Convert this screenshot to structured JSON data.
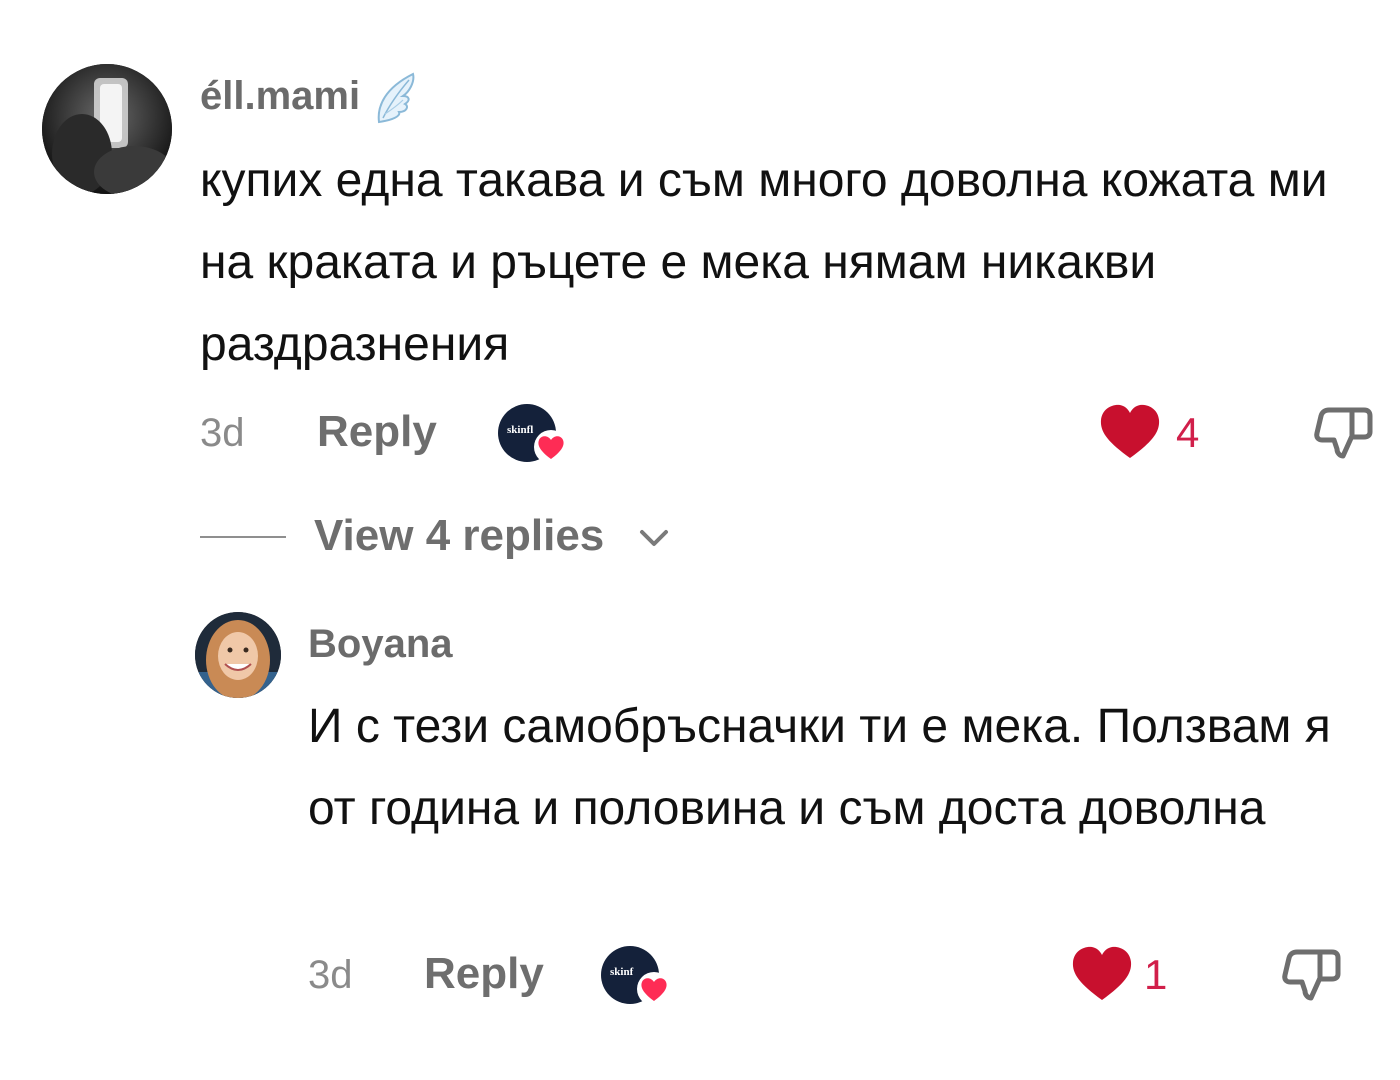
{
  "comments": [
    {
      "username": "éll.mami",
      "username_icon": "angel-wing-icon",
      "text": "купих една такава и съм много доволна кожата ми на краката и ръцете е мека нямам никакви раздразнения",
      "time": "3d",
      "reply_label": "Reply",
      "creator_avatar_text": "skinfl",
      "like_count": "4",
      "view_replies_label": "View 4 replies"
    },
    {
      "username": "Boyana",
      "text": "И с тези самобръсначки ти е мека. Ползвам я от година и половина и съм доста доволна",
      "time": "3d",
      "reply_label": "Reply",
      "creator_avatar_text": "skinf",
      "like_count": "1"
    }
  ],
  "colors": {
    "like": "#d11f4a",
    "secondary_text": "#6e6e6e",
    "timestamp": "#8a8a8a",
    "body_text": "#111111"
  }
}
